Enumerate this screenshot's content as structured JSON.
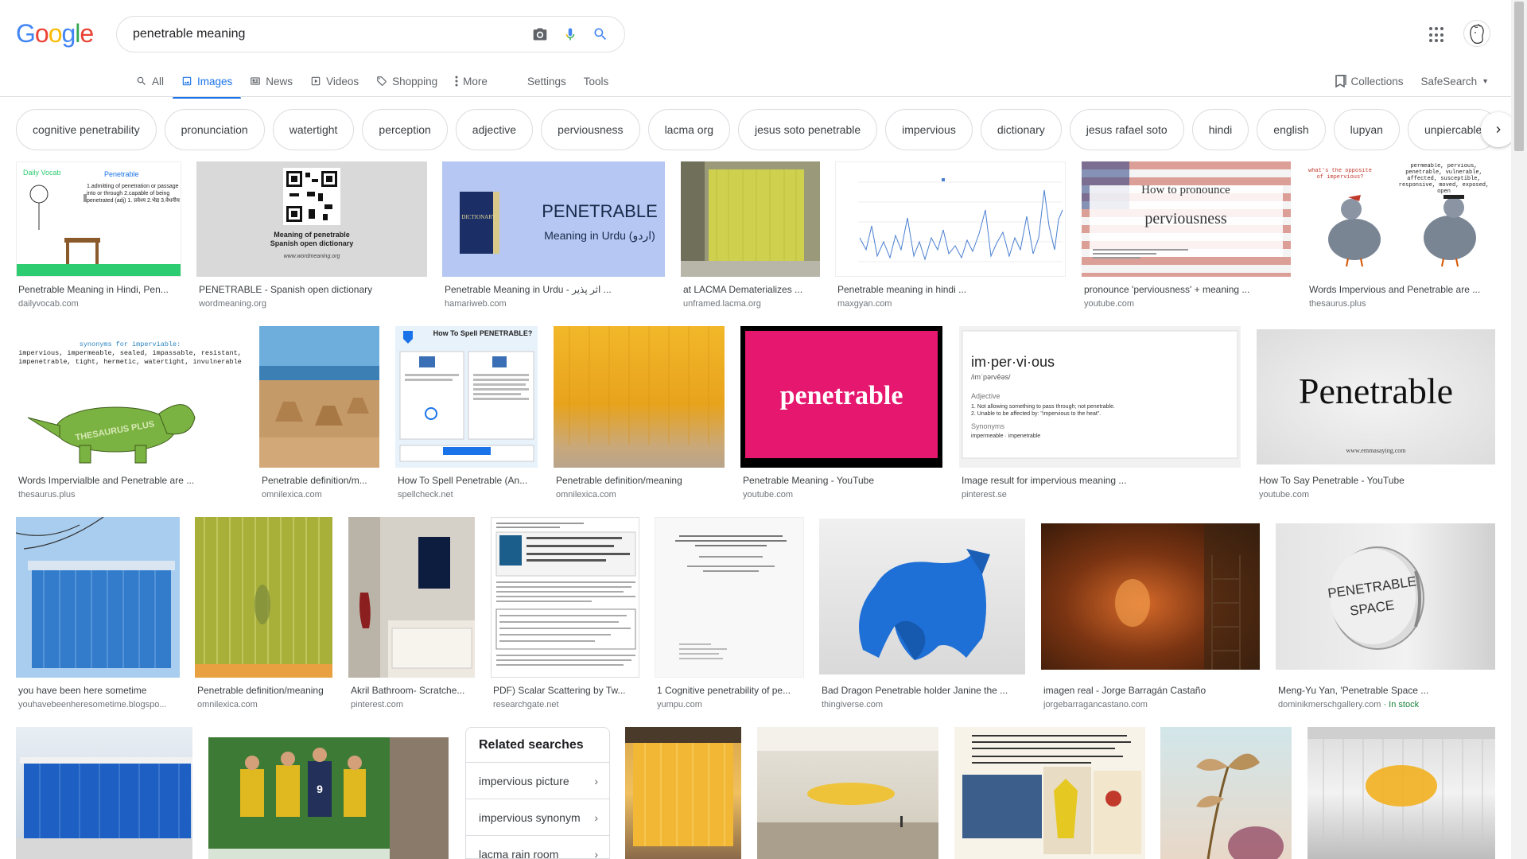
{
  "header": {
    "logo": [
      "G",
      "o",
      "o",
      "g",
      "l",
      "e"
    ],
    "logo_colors": [
      "#4285F4",
      "#EA4335",
      "#FBBC05",
      "#4285F4",
      "#34A853",
      "#EA4335"
    ],
    "search_value": "penetrable meaning"
  },
  "tabs": {
    "all": "All",
    "images": "Images",
    "news": "News",
    "videos": "Videos",
    "shopping": "Shopping",
    "more": "More",
    "settings": "Settings",
    "tools": "Tools"
  },
  "right_tools": {
    "collections": "Collections",
    "safesearch": "SafeSearch"
  },
  "chips": [
    "cognitive penetrability",
    "pronunciation",
    "watertight",
    "perception",
    "adjective",
    "perviousness",
    "lacma org",
    "jesus soto penetrable",
    "impervious",
    "dictionary",
    "jesus rafael soto",
    "hindi",
    "english",
    "lupyan",
    "unpiercable"
  ],
  "results": [
    {
      "title": "Penetrable Meaning in Hindi, Pen...",
      "source": "dailyvocab.com"
    },
    {
      "title": "PENETRABLE - Spanish open dictionary",
      "source": "wordmeaning.org"
    },
    {
      "title": "Penetrable Meaning in Urdu - اثر پذیر ...",
      "source": "hamariweb.com"
    },
    {
      "title": "at LACMA Dematerializes ...",
      "source": "unframed.lacma.org"
    },
    {
      "title": "Penetrable meaning in hindi ...",
      "source": "maxgyan.com"
    },
    {
      "title": "pronounce 'perviousness' + meaning ...",
      "source": "youtube.com"
    },
    {
      "title": "Words Impervious and Penetrable are ...",
      "source": "thesaurus.plus"
    },
    {
      "title": "Words Impervialble and Penetrable are ...",
      "source": "thesaurus.plus"
    },
    {
      "title": "Penetrable definition/m...",
      "source": "omnilexica.com"
    },
    {
      "title": "How To Spell Penetrable (An...",
      "source": "spellcheck.net"
    },
    {
      "title": "Penetrable definition/meaning",
      "source": "omnilexica.com"
    },
    {
      "title": "Penetrable Meaning - YouTube",
      "source": "youtube.com"
    },
    {
      "title": "Image result for impervious meaning ...",
      "source": "pinterest.se"
    },
    {
      "title": "How To Say Penetrable - YouTube",
      "source": "youtube.com"
    },
    {
      "title": "you have been here sometime",
      "source": "youhavebeenheresometime.blogspo..."
    },
    {
      "title": "Penetrable definition/meaning",
      "source": "omnilexica.com"
    },
    {
      "title": "Akril Bathroom- Scratche...",
      "source": "pinterest.com"
    },
    {
      "title": "PDF) Scalar Scattering by Tw...",
      "source": "researchgate.net"
    },
    {
      "title": "1 Cognitive penetrability of pe...",
      "source": "yumpu.com"
    },
    {
      "title": "Bad Dragon Penetrable holder Janine the ...",
      "source": "thingiverse.com"
    },
    {
      "title": "imagen real - Jorge Barragán Castaño",
      "source": "jorgebarragancastano.com"
    },
    {
      "title": "Meng-Yu Yan, 'Penetrable Space ...",
      "source": "dominikmerschgallery.com",
      "stock": " · In stock"
    }
  ],
  "thumb_text": {
    "dailyvocab_title": "Penetrable",
    "dailyvocab_def": "1.admitting of penetration or passage into or through 2.capable of being penetrated (adj) 1. प्रवेश्य 2.भेद्य 3.वेधनीय",
    "dailyvocab_brand": "Daily Vocab",
    "qr_caption1": "Meaning of penetrable",
    "qr_caption2": "Spanish open dictionary",
    "qr_url": "www.wordmeaning.org",
    "urdu_big": "PENETRABLE",
    "urdu_sub": "Meaning in Urdu (اردو)",
    "pron_line1": "How to pronounce",
    "pron_line2": "perviousness",
    "pigeon_q": "what's the opposite of impervious?",
    "pigeon_list": "permeable, pervious, penetrable, vulnerable, affected, susceptible, responsive, moved, exposed, open",
    "syn_title": "synonyms for imperviable:",
    "syn_list": "impervious, impermeable, sealed, impassable, resistant, impenetrable, tight, hermetic, watertight, invulnerable",
    "syn_brand": "THESAURUS PLUS",
    "spell_title": "How To Spell PENETRABLE?",
    "pink_word": "penetrable",
    "imp_word": "im·per·vi·ous",
    "imp_phon": "/imˈpərvēəs/",
    "imp_pos": "Adjective",
    "imp_def1": "1.  Not allowing something to pass through; not penetrable.",
    "imp_def2": "2.  Unable to be affected by: \"impervious to the heat\".",
    "imp_syn": "Synonyms",
    "imp_synlist": "impermeable · impenetrable",
    "say_word": "Penetrable",
    "say_url": "www.emmasaying.com",
    "coin1": "PENETRABLE",
    "coin2": "SPACE"
  },
  "related": {
    "title": "Related searches",
    "items": [
      "impervious picture",
      "impervious synonym",
      "lacma rain room"
    ]
  }
}
